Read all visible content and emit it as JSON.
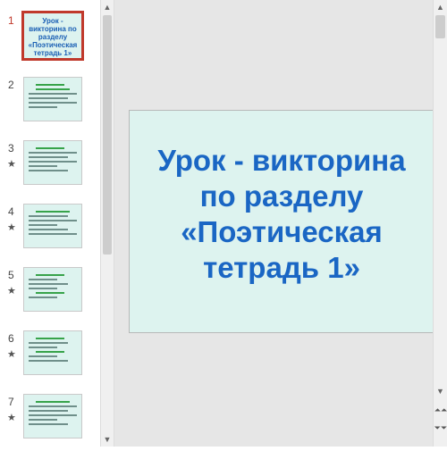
{
  "thumbnails": [
    {
      "number": "1",
      "star": "",
      "title": "Урок - викторина по разделу «Поэтическая тетрадь 1»"
    },
    {
      "number": "2",
      "star": ""
    },
    {
      "number": "3",
      "star": "★"
    },
    {
      "number": "4",
      "star": "★"
    },
    {
      "number": "5",
      "star": "★"
    },
    {
      "number": "6",
      "star": "★"
    },
    {
      "number": "7",
      "star": "★"
    }
  ],
  "slide": {
    "title_lines": [
      "Урок - викторина",
      "по разделу",
      "«Поэтическая",
      "тетрадь 1»"
    ]
  },
  "icons": {
    "scroll_up": "triangle-up",
    "scroll_down": "triangle-down",
    "prev_slide": "double-chevron-up",
    "next_slide": "double-chevron-down"
  },
  "colors": {
    "slide_background": "#ddf3ef",
    "title_text": "#1a66c4",
    "selected_border": "#c0392b"
  }
}
